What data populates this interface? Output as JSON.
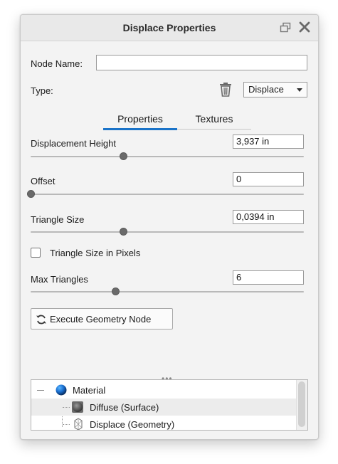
{
  "window": {
    "title": "Displace Properties",
    "float_icon": "float-window-icon",
    "close_icon": "close-icon"
  },
  "node": {
    "name_label": "Node Name:",
    "name_value": "",
    "type_label": "Type:",
    "type_value": "Displace",
    "delete_icon": "trash-icon"
  },
  "tabs": [
    {
      "label": "Properties",
      "active": true
    },
    {
      "label": "Textures",
      "active": false
    }
  ],
  "fields": {
    "displacement_height": {
      "label": "Displacement Height",
      "value": "3,937 in",
      "slider_fraction": 0.34
    },
    "offset": {
      "label": "Offset",
      "value": "0",
      "slider_fraction": 0.0
    },
    "triangle_size": {
      "label": "Triangle Size",
      "value": "0,0394 in",
      "slider_fraction": 0.34
    },
    "triangle_size_in_pixels": {
      "label": "Triangle Size in Pixels",
      "checked": false
    },
    "max_triangles": {
      "label": "Max Triangles",
      "value": "6",
      "slider_fraction": 0.31
    }
  },
  "execute_button": {
    "label": "Execute Geometry Node",
    "icon": "refresh-icon"
  },
  "grip": "•••",
  "tree": {
    "items": [
      {
        "label": "Material",
        "icon": "sphere-icon",
        "level": 0
      },
      {
        "label": "Diffuse (Surface)",
        "icon": "diffuse-icon",
        "level": 1,
        "selected": true
      },
      {
        "label": "Displace (Geometry)",
        "icon": "geometry-icon",
        "level": 1
      }
    ]
  },
  "colors": {
    "accent": "#1a73c8",
    "panel_bg": "#f3f3f3",
    "titlebar_bg": "#e9e9e9"
  }
}
